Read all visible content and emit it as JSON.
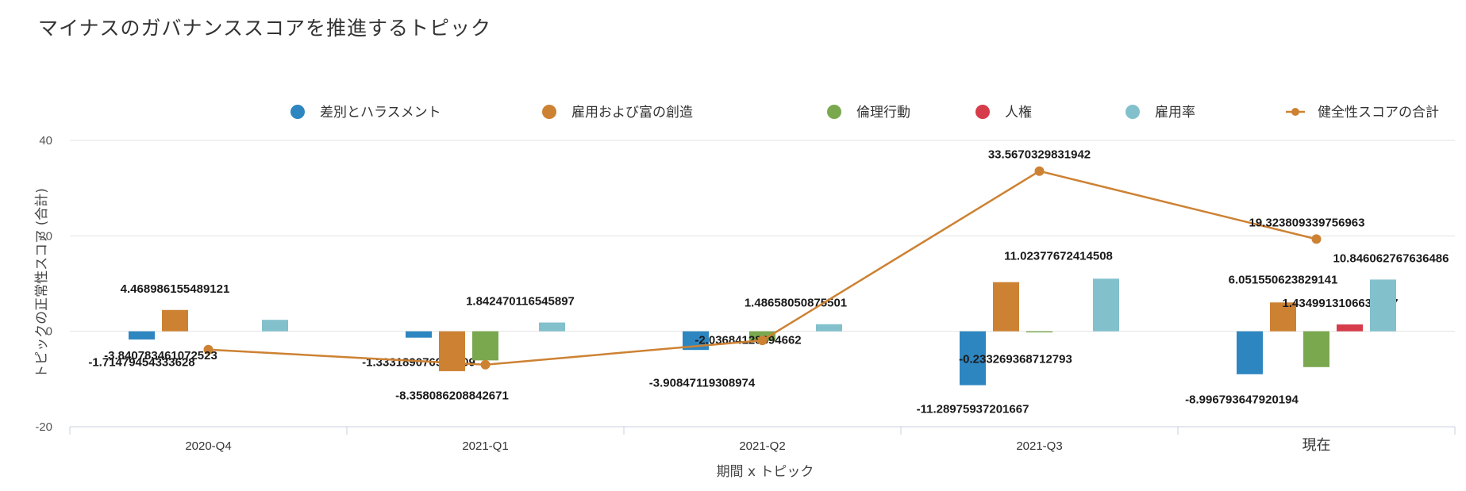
{
  "chart_data": {
    "type": "bar",
    "title": "マイナスのガバナンススコアを推進するトピック",
    "xlabel": "期間 x トピック",
    "ylabel": "トピックの正常性スコア (合計)",
    "categories": [
      "2020-Q4",
      "2021-Q1",
      "2021-Q2",
      "2021-Q3",
      "現在"
    ],
    "ylim": [
      -20,
      40
    ],
    "yticks": [
      -20,
      0,
      20,
      40
    ],
    "ytick_labels": [
      "-20",
      "0",
      "20",
      "40"
    ],
    "grid": true,
    "legend_position": "top",
    "series": [
      {
        "name": "差別とハラスメント",
        "kind": "bar",
        "color": "#2e86c1",
        "values": [
          -1.71479454333628,
          -1.333189076976909,
          -3.90847119308974,
          -11.28975937201667,
          -8.996793647920194
        ],
        "labels": [
          "-1.71479454333628",
          "-1.333189076976909",
          "-3.90847119308974",
          "-11.28975937201667",
          "-8.996793647920194"
        ]
      },
      {
        "name": "雇用および富の創造",
        "kind": "bar",
        "color": "#cd8233",
        "values": [
          4.468986155489121,
          -8.358086208842671,
          0,
          10.3,
          6.051550623829141
        ],
        "labels": [
          "4.468986155489121",
          "-8.358086208842671",
          "",
          "",
          "6.051550623829141"
        ]
      },
      {
        "name": "倫理行動",
        "kind": "bar",
        "color": "#7aa84f",
        "values": [
          0,
          -6.1,
          -2.03684128394662,
          -0.233269368712793,
          -7.5
        ],
        "labels": [
          "",
          "",
          "-2.03684128394662",
          "-0.233269368712793",
          ""
        ]
      },
      {
        "name": "人権",
        "kind": "bar",
        "color": "#d63c4a",
        "values": [
          0,
          0,
          0,
          0,
          1.4349913106633247
        ],
        "labels": [
          "",
          "",
          "",
          "",
          "1.4349913106633247"
        ]
      },
      {
        "name": "雇用率",
        "kind": "bar",
        "color": "#82c0cc",
        "values": [
          2.4,
          1.842470116545897,
          1.48658050875501,
          11.02377672414508,
          10.846062767636486
        ],
        "labels": [
          "",
          "1.842470116545897",
          "1.48658050875501",
          "11.02377672414508",
          "10.846062767636486"
        ]
      },
      {
        "name": "健全性スコアの合計",
        "kind": "line",
        "color": "#cd8233",
        "values": [
          -3.840783461072523,
          -7.0,
          -1.9,
          33.5670329831942,
          19.323809339756963
        ],
        "labels": [
          "-3.840783461072523",
          "",
          "",
          "33.5670329831942",
          "19.323809339756963"
        ]
      }
    ]
  }
}
